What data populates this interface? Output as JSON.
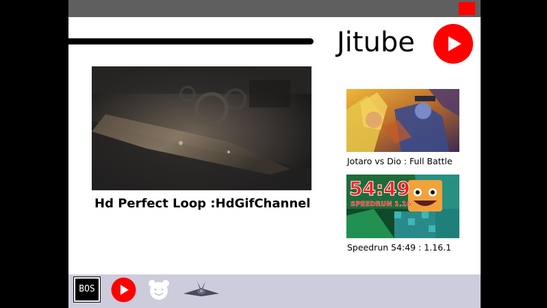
{
  "app": {
    "title": "Jitube"
  },
  "icons": {
    "close": "close-icon",
    "logo": "play-logo-icon",
    "taskbar": [
      "bos-icon",
      "jitube-play-icon",
      "bear-face-icon",
      "jet-plane-icon"
    ]
  },
  "colors": {
    "accent": "#ff0000",
    "titlebar": "#5f5f5f",
    "taskbar": "#ccccdc"
  },
  "main": {
    "video_title": "Hd Perfect Loop :HdGifChannel"
  },
  "sidebar": {
    "videos": [
      {
        "title": "Jotaro vs Dio : Full Battle"
      },
      {
        "title": "Speedrun 54:49 : 1.16.1",
        "thumb_text": "54:49",
        "thumb_subtext": "SPEEDRUN 1.16"
      }
    ]
  },
  "taskbar": {
    "bos_label": "BOS"
  }
}
